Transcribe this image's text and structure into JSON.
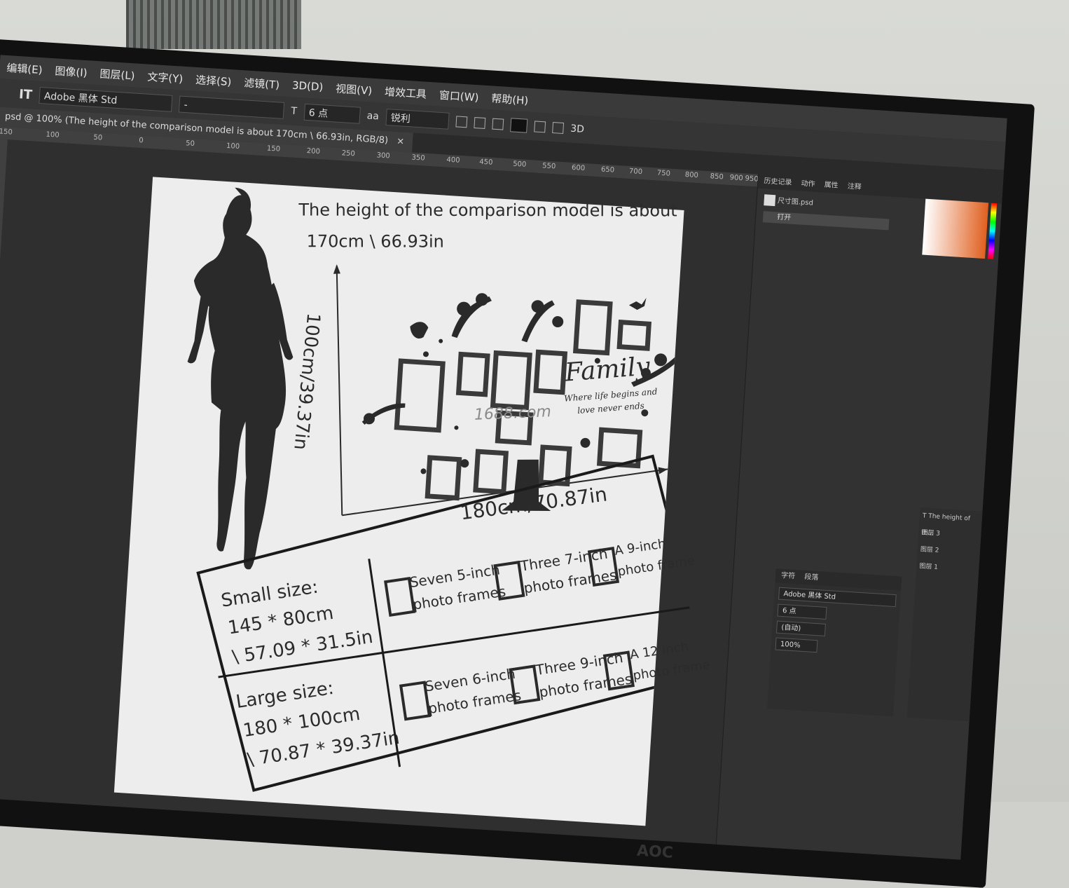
{
  "menu": [
    "编辑(E)",
    "图像(I)",
    "图层(L)",
    "文字(Y)",
    "选择(S)",
    "滤镜(T)",
    "3D(D)",
    "视图(V)",
    "增效工具",
    "窗口(W)",
    "帮助(H)"
  ],
  "options": {
    "font_family": "Adobe 黑体 Std",
    "font_style": "-",
    "font_size": "6 点",
    "antialias_label": "aa",
    "antialias": "锐利",
    "threed": "3D"
  },
  "document_tab": {
    "title": "psd @ 100% (The height of the comparison model is about  170cm \\ 66.93in, RGB/8)",
    "close": "×"
  },
  "ruler_marks": [
    "150",
    "100",
    "50",
    "0",
    "50",
    "100",
    "150",
    "200",
    "250",
    "300",
    "350",
    "400",
    "450",
    "500",
    "550",
    "600",
    "650",
    "700",
    "750",
    "800",
    "850",
    "900",
    "950"
  ],
  "artwork": {
    "headline_1": "The height of the comparison model is about",
    "headline_2": "170cm \\ 66.93in",
    "height_dim": "100cm/39.37in",
    "width_dim": "180cm/70.87in",
    "brand": "Family",
    "slogan_1": "Where life begins and",
    "slogan_2": "love never ends",
    "watermark": "1688.com",
    "small_title": "Small size:",
    "small_cm": "145 * 80cm",
    "small_in": "\\ 57.09 * 31.5in",
    "large_title": "Large size:",
    "large_cm": "180 * 100cm",
    "large_in": "\\ 70.87 * 39.37in",
    "small_opts": [
      {
        "l1": "Seven 5-inch",
        "l2": "photo frames"
      },
      {
        "l1": "Three 7-inch",
        "l2": "photo frames"
      },
      {
        "l1": "A 9-inch",
        "l2": "photo frame"
      }
    ],
    "large_opts": [
      {
        "l1": "Seven 6-inch",
        "l2": "photo frames"
      },
      {
        "l1": "Three 9-inch",
        "l2": "photo frames"
      },
      {
        "l1": "A 12 inch",
        "l2": "photo frame"
      }
    ]
  },
  "history_panel": {
    "tabs": [
      "历史记录",
      "动作",
      "属性",
      "注释"
    ],
    "snapshot": "尺寸图.psd",
    "step": "打开"
  },
  "char_panel": {
    "tabs": [
      "字符",
      "段落"
    ],
    "font": "Adobe 黑体 Std",
    "size": "6 点",
    "leading": "(自动)",
    "scale": "100%"
  },
  "layers_panel": {
    "type_layer": "The height of th...",
    "layers": [
      "图层 3",
      "图层 2",
      "图层 1"
    ]
  },
  "monitor_brand": "AOC"
}
